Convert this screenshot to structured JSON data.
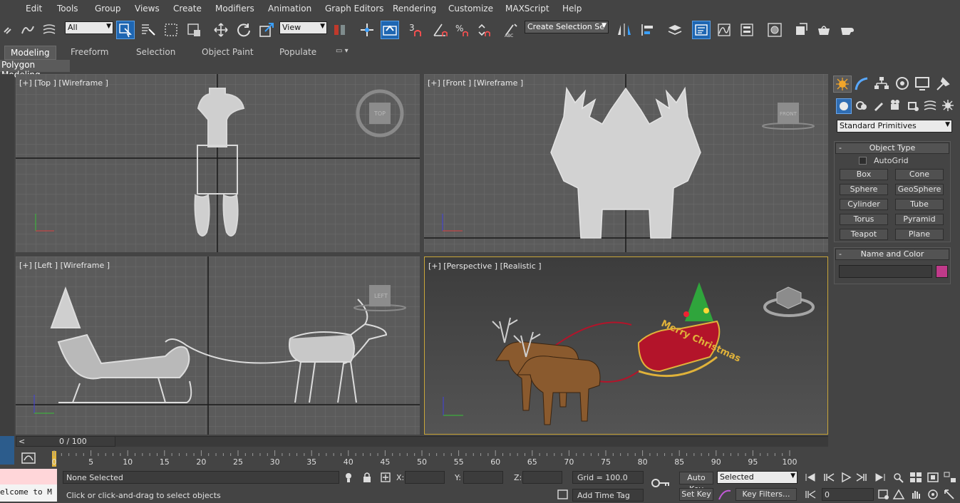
{
  "menu": {
    "items": [
      "Edit",
      "Tools",
      "Group",
      "Views",
      "Create",
      "Modifiers",
      "Animation",
      "Graph Editors",
      "Rendering",
      "Customize",
      "MAXScript",
      "Help"
    ]
  },
  "toolbar": {
    "selection_filter": "All",
    "ref_coord": "View",
    "named_selection": "Create Selection Se",
    "snap_3": "3",
    "icons": [
      "link-icon",
      "unlink-icon",
      "bind-space-warp-icon",
      "select-object-icon",
      "select-by-name-icon",
      "rectangular-region-icon",
      "window-crossing-icon",
      "move-icon",
      "rotate-icon",
      "scale-icon",
      "pivot-icon",
      "manipulate-icon",
      "keyboard-shortcut-icon",
      "snap-icon",
      "angle-snap-icon",
      "percent-snap-icon",
      "spinner-snap-icon",
      "edit-named-selection-icon",
      "mirror-icon",
      "align-icon",
      "layer-manager-icon",
      "scene-explorer-icon",
      "curve-editor-icon",
      "schematic-view-icon",
      "material-editor-icon",
      "render-setup-icon",
      "rendered-frame-window-icon",
      "render-production-icon",
      "render-iterative-icon"
    ]
  },
  "ribbon": {
    "tabs": [
      "Modeling",
      "Freeform",
      "Selection",
      "Object Paint",
      "Populate"
    ],
    "active_tab": "Modeling",
    "sub_label": "Polygon Modeling"
  },
  "viewports": {
    "top": {
      "label": "[+] [Top ] [Wireframe ]",
      "cube": "TOP"
    },
    "front": {
      "label": "[+] [Front ] [Wireframe ]",
      "cube": "FRONT"
    },
    "left": {
      "label": "[+] [Left ] [Wireframe ]",
      "cube": "LEFT"
    },
    "perspective": {
      "label": "[+] [Perspective ] [Realistic ]",
      "banner": "Merry Christmas"
    }
  },
  "command_panel": {
    "tab_icons": [
      "create-icon",
      "modify-icon",
      "hierarchy-icon",
      "motion-icon",
      "display-icon",
      "utilities-icon"
    ],
    "category_icons": [
      "geometry-icon",
      "shapes-icon",
      "lights-icon",
      "cameras-icon",
      "helpers-icon",
      "space-warps-icon",
      "systems-icon"
    ],
    "dropdown": "Standard Primitives",
    "object_type_title": "Object Type",
    "autogrid": "AutoGrid",
    "buttons": [
      "Box",
      "Cone",
      "Sphere",
      "GeoSphere",
      "Cylinder",
      "Tube",
      "Torus",
      "Pyramid",
      "Teapot",
      "Plane"
    ],
    "name_color_title": "Name and Color",
    "object_color": "#c03a8a"
  },
  "timeline": {
    "frame_counter": "0 / 100",
    "prev": "<",
    "next": ">",
    "ticks": [
      "0",
      "5",
      "10",
      "15",
      "20",
      "25",
      "30",
      "35",
      "40",
      "45",
      "50",
      "55",
      "60",
      "65",
      "70",
      "75",
      "80",
      "85",
      "90",
      "95",
      "100"
    ]
  },
  "status": {
    "selection": "None Selected",
    "prompt": "Click or click-and-drag to select objects",
    "x_label": "X:",
    "y_label": "Y:",
    "z_label": "Z:",
    "grid": "Grid = 100.0",
    "add_time_tag": "Add Time Tag",
    "auto_key": "Auto Key",
    "set_key": "Set Key",
    "key_mode": "Selected",
    "key_filters": "Key Filters...",
    "current_frame": "0",
    "listener": "elcome to M"
  }
}
